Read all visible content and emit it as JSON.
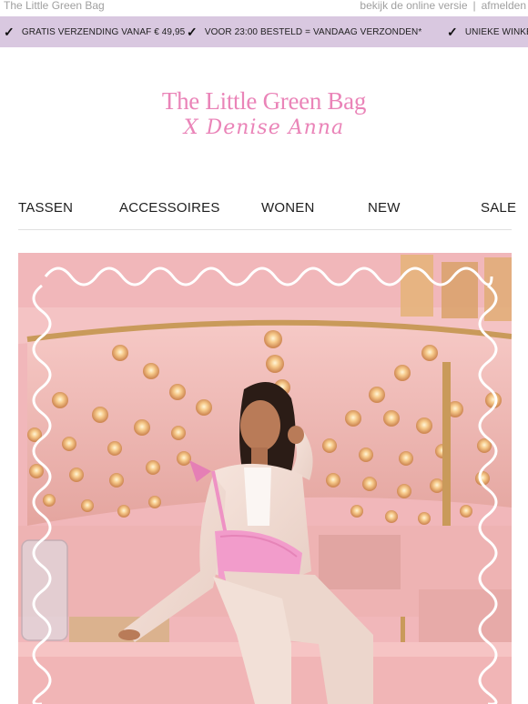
{
  "topbar": {
    "brand": "The Little Green Bag",
    "online_version": "bekijk de online versie",
    "separator": "|",
    "unsubscribe": "afmelden"
  },
  "usp": [
    {
      "icon": "check-icon",
      "text": "GRATIS VERZENDING VANAF € 49,95"
    },
    {
      "icon": "check-icon",
      "text": "VOOR 23:00 BESTELD = VANDAAG VERZONDEN*"
    },
    {
      "icon": "check-icon",
      "text": "UNIEKE WINKEL"
    }
  ],
  "logo": {
    "line1": "The Little Green Bag",
    "line2": "X Denise Anna",
    "color": "#ea84b8"
  },
  "nav": {
    "items": [
      "TASSEN",
      "ACCESSOIRES",
      "WONEN",
      "NEW",
      "SALE"
    ]
  },
  "hero": {
    "subject": "woman-with-pink-bag-photo",
    "frame_color": "#ffffff"
  },
  "colors": {
    "usp_bar": "#d9c8e0",
    "hero_pink": "#efb0b4",
    "gold": "#c99a5a"
  }
}
